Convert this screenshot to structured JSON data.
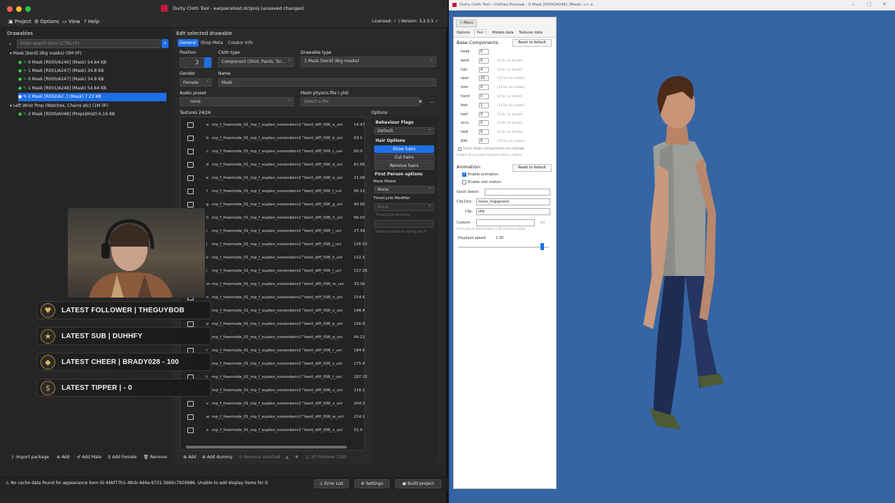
{
  "main_window": {
    "title": "Durty Cloth Tool - earpiecetest.dctproj (unsaved changes)",
    "menu": [
      "Project",
      "Options",
      "View",
      "Help"
    ],
    "license": "Licensed: ✓ | Version: 3.2.0.5 ✓",
    "drawables": {
      "heading": "Drawables",
      "search_placeholder": "Enter search term (CTRL+F)",
      "tree": [
        {
          "label": "Mask [berd] (Big masks) (0M 0F)",
          "level": 0
        },
        {
          "label": "0 Mask [R000/A246] (Mask) 54.64 KB",
          "level": 1
        },
        {
          "label": "1 Mask [R001/A247] (Mask) 34.8 KB",
          "level": 1
        },
        {
          "label": "0 Mask [R000/A247] (Mask) 34.8 KB",
          "level": 1
        },
        {
          "label": "1 Mask [R001/A248] (Mask) 54.64 KB",
          "level": 1
        },
        {
          "label": "2 Mask [R002/A2..] (Mask) 7.23 KB",
          "level": 1,
          "selected": true
        },
        {
          "label": "Left Wrist Prop (Watches, Chains etc) (1M 0F)",
          "level": 0
        },
        {
          "label": "2 Mask [R000/A048] (PropLWrist) 6.16 KB",
          "level": 1
        }
      ],
      "buttons": [
        "Import package",
        "Add",
        "Add Male",
        "Add Female",
        "Remove"
      ]
    },
    "edit": {
      "heading": "Edit selected drawable",
      "tabs": [
        "General",
        "Shop Meta",
        "Creator Info"
      ],
      "position_label": "Position",
      "position_value": "2",
      "cloth_type_label": "Cloth type",
      "cloth_type_value": "Component (Shirt, Pants, Tor...",
      "drawable_type_label": "Drawable type",
      "drawable_type_value": "1   Mask [berd] (Big masks)",
      "gender_label": "Gender",
      "gender_value": "Female",
      "name_label": "Name",
      "name_value": "Mask",
      "audio_label": "Audio preset",
      "audio_value": "none",
      "mesh_label": "Mesh physics file (.yld)",
      "mesh_placeholder": "Select a file",
      "textures_heading": "Textures 24/26",
      "textures": [
        {
          "letter": "a",
          "name": "mp_f_freemode_01_mp_f_eupleo_novemberv1^berd_diff_006_a_uni",
          "size": "14.47"
        },
        {
          "letter": "b",
          "name": "mp_f_freemode_01_mp_f_eupleo_novemberv1^berd_diff_006_b_uni",
          "size": "63.1"
        },
        {
          "letter": "c",
          "name": "mp_f_freemode_01_mp_f_eupleo_novemberv1^berd_diff_006_c_uni",
          "size": "60.9"
        },
        {
          "letter": "d",
          "name": "mp_f_freemode_01_mp_f_eupleo_novemberv1^berd_diff_006_d_uni",
          "size": "62.85"
        },
        {
          "letter": "e",
          "name": "mp_f_freemode_01_mp_f_eupleo_novemberv1^berd_diff_006_e_uni",
          "size": "21.09"
        },
        {
          "letter": "f",
          "name": "mp_f_freemode_01_mp_f_eupleo_novemberv1^berd_diff_006_f_uni",
          "size": "95.12"
        },
        {
          "letter": "g",
          "name": "mp_f_freemode_01_mp_f_eupleo_novemberv1^berd_diff_006_g_uni",
          "size": "90.95"
        },
        {
          "letter": "h",
          "name": "mp_f_freemode_01_mp_f_eupleo_novemberv1^berd_diff_006_h_uni",
          "size": "96.03"
        },
        {
          "letter": "i",
          "name": "mp_f_freemode_01_mp_f_eupleo_novemberv1^berd_diff_006_i_uni",
          "size": "27.39"
        },
        {
          "letter": "j",
          "name": "mp_f_freemode_01_mp_f_eupleo_novemberv1^berd_diff_006_j_uni",
          "size": "126.52"
        },
        {
          "letter": "k",
          "name": "mp_f_freemode_01_mp_f_eupleo_novemberv1^berd_diff_006_k_uni",
          "size": "122.5"
        },
        {
          "letter": "l",
          "name": "mp_f_freemode_01_mp_f_eupleo_novemberv1^berd_diff_006_l_uni",
          "size": "127.29"
        },
        {
          "letter": "m",
          "name": "mp_f_freemode_01_mp_f_eupleo_novemberv1^berd_diff_006_m_uni",
          "size": "33.36"
        },
        {
          "letter": "n",
          "name": "mp_f_freemode_01_mp_f_eupleo_novemberv1^berd_diff_006_n_uni",
          "size": "154.6"
        },
        {
          "letter": "o",
          "name": "mp_f_freemode_01_mp_f_eupleo_novemberv1^berd_diff_006_o_uni",
          "size": "148.4"
        },
        {
          "letter": "p",
          "name": "mp_f_freemode_01_mp_f_eupleo_novemberv1^berd_diff_006_p_uni",
          "size": "156.9"
        },
        {
          "letter": "q",
          "name": "mp_f_freemode_01_mp_f_eupleo_novemberv1^berd_diff_006_q_uni",
          "size": "44.21"
        },
        {
          "letter": "r",
          "name": "mp_f_freemode_01_mp_f_eupleo_novemberv1^berd_diff_006_r_uni",
          "size": "184.6"
        },
        {
          "letter": "s",
          "name": "mp_f_freemode_01_mp_f_eupleo_novemberv1^berd_diff_006_s_uni",
          "size": "175.4"
        },
        {
          "letter": "t",
          "name": "mp_f_freemode_01_mp_f_eupleo_novemberv1^berd_diff_006_t_uni",
          "size": "187.15"
        },
        {
          "letter": "u",
          "name": "mp_f_freemode_01_mp_f_eupleo_novemberv1^berd_diff_006_u_uni",
          "size": "218.1"
        },
        {
          "letter": "v",
          "name": "mp_f_freemode_01_mp_f_eupleo_novemberv1^berd_diff_006_v_uni",
          "size": "204.3"
        },
        {
          "letter": "w",
          "name": "mp_f_freemode_01_mp_f_eupleo_novemberv1^berd_diff_006_w_uni",
          "size": "214.1"
        },
        {
          "letter": "x",
          "name": "mp_f_freemode_01_mp_f_eupleo_novemberv1^berd_diff_006_x_uni",
          "size": "51.9"
        }
      ],
      "texture_buttons": [
        "Add",
        "Add dummy",
        "Remove selected",
        "3D Preview Cloth"
      ],
      "options": {
        "heading": "Options",
        "behaviour_label": "Behaviour Flags",
        "behaviour_value": "Default",
        "hair_label": "Hair Options",
        "hair_buttons": [
          "Show hairs",
          "Cut hairs",
          "Remove hairs"
        ],
        "fp_label": "First Person options",
        "mask_model_label": "Mask Model",
        "mask_model_value": "None",
        "timecycle_label": "TimeCycle Modifier",
        "timecycle_value": "None",
        "timecycle_intensity": "TimeCycle Intensity",
        "select_texture_note": "Select texture to configure TI"
      }
    },
    "status": {
      "message": "No cache data found for appearance item ID 44bf77b1-48cb-4d4a-9731-5bb5c7926986. Unable to add display items for it.",
      "buttons": [
        "Error List",
        "Settings",
        "Build project"
      ]
    }
  },
  "stream_overlay": [
    {
      "icon": "heart-icon",
      "glyph": "♥",
      "text": "LATEST FOLLOWER | THEGUYBOB"
    },
    {
      "icon": "star-icon",
      "glyph": "★",
      "text": "LATEST SUB | DUHHFY"
    },
    {
      "icon": "diamond-icon",
      "glyph": "◆",
      "text": "LATEST CHEER | BRADY028 - 100"
    },
    {
      "icon": "dollar-icon",
      "glyph": "$",
      "text": "LATEST TIPPER |  -  0"
    }
  ],
  "preview_window": {
    "title": "Durty Cloth Tool - Clothes Preview - 0 Mask [R000/A246] (Mask) <> a",
    "menu_button": "< Menu",
    "tabs": [
      "Options",
      "Ped",
      "Models data",
      "Textures data"
    ],
    "base_components_label": "Base Components:",
    "reset_label": "Reset to default",
    "components": [
      {
        "name": "head",
        "value": "0",
        "note": ""
      },
      {
        "name": "berd",
        "value": "0",
        "note": "(0 for no model)"
      },
      {
        "name": "hair",
        "value": "4",
        "note": "(0 for no model)"
      },
      {
        "name": "uppr",
        "value": "15",
        "note": "(13 for no model)"
      },
      {
        "name": "lowr",
        "value": "0",
        "note": "(11 for no model)"
      },
      {
        "name": "hand",
        "value": "0",
        "note": "(0 for no model)"
      },
      {
        "name": "feet",
        "value": "1",
        "note": "(13 for no model)"
      },
      {
        "name": "teef",
        "value": "0",
        "note": "(0 for no model)"
      },
      {
        "name": "accs",
        "value": "0",
        "note": "(0 for no model)"
      },
      {
        "name": "task",
        "value": "0",
        "note": "(0 for no model)"
      },
      {
        "name": "jbib",
        "value": "0",
        "note": "(15 for no model)"
      }
    ],
    "dont_reset": "Dont reset components on change",
    "dont_reset_note": "Enable to preview multiple addon clothes",
    "animation_label": "Animation:",
    "enable_animation": "Enable animation",
    "enable_root_motion": "Enable root motion",
    "quick_select": "Quick Select:",
    "clip_dict_label": "Clip Dict:",
    "clip_dict_value": "move_m@generic",
    "clip_label": "Clip:",
    "clip_value": "idle",
    "custom_label": "Custom:",
    "custom_note": "Put Custom Animations in DCT/anims folder.",
    "playback_label": "Playback speed:",
    "playback_value": "1.00",
    "playback_fraction": 0.92
  },
  "colors": {
    "accent": "#1f6fe6",
    "preview_bg": "#3565a4",
    "app_bg": "#252526",
    "overlay_gold": "#e7b64b"
  }
}
